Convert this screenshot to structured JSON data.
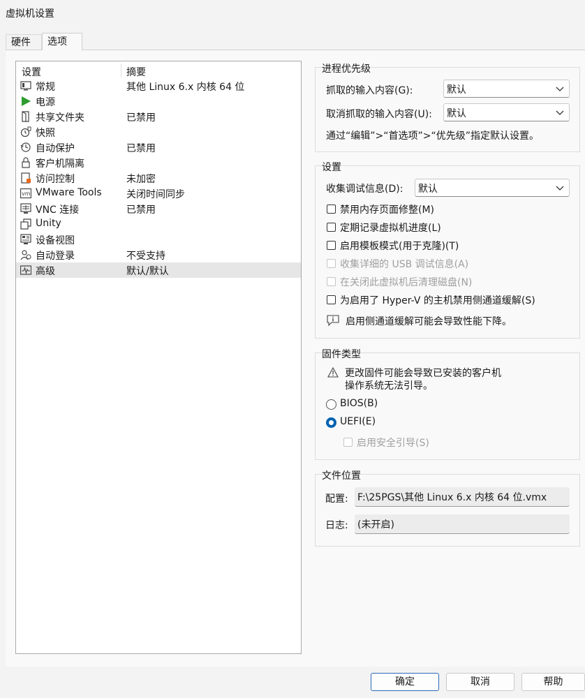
{
  "window": {
    "title": "虚拟机设置"
  },
  "tabs": [
    {
      "label": "硬件",
      "active": false
    },
    {
      "label": "选项",
      "active": true
    }
  ],
  "device_list": {
    "headers": [
      "设置",
      "摘要"
    ],
    "rows": [
      {
        "name": "常规",
        "summary": "其他 Linux 6.x 内核 64 位",
        "icon": "general-icon"
      },
      {
        "name": "电源",
        "summary": "",
        "icon": "power-play-icon"
      },
      {
        "name": "共享文件夹",
        "summary": "已禁用",
        "icon": "shared-folder-icon"
      },
      {
        "name": "快照",
        "summary": "",
        "icon": "snapshot-icon"
      },
      {
        "name": "自动保护",
        "summary": "已禁用",
        "icon": "autoprotect-icon"
      },
      {
        "name": "客户机隔离",
        "summary": "",
        "icon": "lock-icon"
      },
      {
        "name": "访问控制",
        "summary": "未加密",
        "icon": "access-control-icon"
      },
      {
        "name": "VMware Tools",
        "summary": "关闭时间同步",
        "icon": "vmware-tools-icon"
      },
      {
        "name": "VNC 连接",
        "summary": "已禁用",
        "icon": "vnc-icon"
      },
      {
        "name": "Unity",
        "summary": "",
        "icon": "unity-icon"
      },
      {
        "name": "设备视图",
        "summary": "",
        "icon": "device-view-icon"
      },
      {
        "name": "自动登录",
        "summary": "不受支持",
        "icon": "autologin-icon"
      },
      {
        "name": "高级",
        "summary": "默认/默认",
        "icon": "advanced-icon",
        "selected": true
      }
    ]
  },
  "process_priority": {
    "title": "进程优先级",
    "grabbed_label": "抓取的输入内容(G):",
    "grabbed_value": "默认",
    "ungrabbed_label": "取消抓取的输入内容(U):",
    "ungrabbed_value": "默认",
    "hint": "通过“编辑”>“首选项”>“优先级”指定默认设置。"
  },
  "settings": {
    "title": "设置",
    "debug_label": "收集调试信息(D):",
    "debug_value": "默认",
    "checkboxes": [
      {
        "label": "禁用内存页面修整(M)",
        "checked": false,
        "enabled": true
      },
      {
        "label": "定期记录虚拟机进度(L)",
        "checked": false,
        "enabled": true
      },
      {
        "label": "启用模板模式(用于克隆)(T)",
        "checked": false,
        "enabled": true
      },
      {
        "label": "收集详细的 USB 调试信息(A)",
        "checked": false,
        "enabled": false
      },
      {
        "label": "在关闭此虚拟机后清理磁盘(N)",
        "checked": false,
        "enabled": false
      },
      {
        "label": "为启用了 Hyper-V 的主机禁用侧通道缓解(S)",
        "checked": false,
        "enabled": true
      }
    ],
    "info": "启用侧通道缓解可能会导致性能下降。"
  },
  "firmware": {
    "title": "固件类型",
    "warning_line1": "更改固件可能会导致已安装的客户机",
    "warning_line2": "操作系统无法引导。",
    "bios_label": "BIOS(B)",
    "uefi_label": "UEFI(E)",
    "selected": "UEFI",
    "secure_boot_label": "启用安全引导(S)"
  },
  "file_location": {
    "title": "文件位置",
    "config_label": "配置:",
    "config_value": "F:\\25PGS\\其他 Linux 6.x 内核 64 位.vmx",
    "log_label": "日志:",
    "log_value": "(未开启)"
  },
  "buttons": {
    "ok": "确定",
    "cancel": "取消",
    "help": "帮助"
  },
  "colors": {
    "accent": "#0063b1",
    "selected_row": "#e6e6e6",
    "power_green": "#2e9c2e"
  }
}
